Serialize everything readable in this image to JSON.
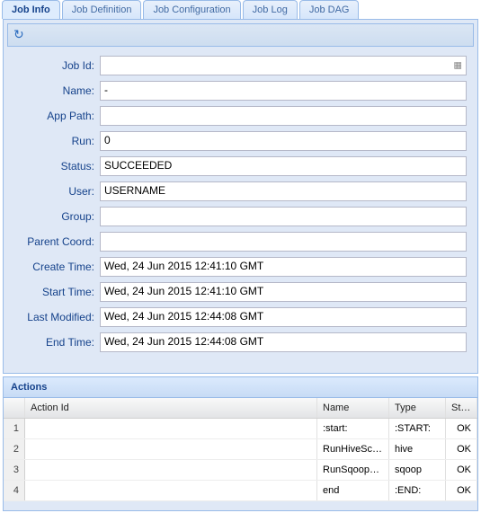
{
  "tabs": [
    {
      "label": "Job Info",
      "active": true
    },
    {
      "label": "Job Definition",
      "active": false
    },
    {
      "label": "Job Configuration",
      "active": false
    },
    {
      "label": "Job Log",
      "active": false
    },
    {
      "label": "Job DAG",
      "active": false
    }
  ],
  "form": {
    "jobId": {
      "label": "Job Id:",
      "value": ""
    },
    "name": {
      "label": "Name:",
      "value": "-"
    },
    "appPath": {
      "label": "App Path:",
      "value": ""
    },
    "run": {
      "label": "Run:",
      "value": "0"
    },
    "status": {
      "label": "Status:",
      "value": "SUCCEEDED"
    },
    "user": {
      "label": "User:",
      "value": "USERNAME"
    },
    "group": {
      "label": "Group:",
      "value": ""
    },
    "parentCoord": {
      "label": "Parent Coord:",
      "value": ""
    },
    "createTime": {
      "label": "Create Time:",
      "value": "Wed, 24 Jun 2015 12:41:10 GMT"
    },
    "startTime": {
      "label": "Start Time:",
      "value": "Wed, 24 Jun 2015 12:41:10 GMT"
    },
    "lastModified": {
      "label": "Last Modified:",
      "value": "Wed, 24 Jun 2015 12:44:08 GMT"
    },
    "endTime": {
      "label": "End Time:",
      "value": "Wed, 24 Jun 2015 12:44:08 GMT"
    }
  },
  "actions": {
    "title": "Actions",
    "columns": {
      "actionId": "Action Id",
      "name": "Name",
      "type": "Type",
      "status": "Statu"
    },
    "rows": [
      {
        "num": "1",
        "actionId": "",
        "name": ":start:",
        "type": ":START:",
        "status": "OK"
      },
      {
        "num": "2",
        "actionId": "",
        "name": "RunHiveScript",
        "type": "hive",
        "status": "OK"
      },
      {
        "num": "3",
        "actionId": "",
        "name": "RunSqoopE…",
        "type": "sqoop",
        "status": "OK"
      },
      {
        "num": "4",
        "actionId": "",
        "name": "end",
        "type": ":END:",
        "status": "OK"
      }
    ]
  }
}
